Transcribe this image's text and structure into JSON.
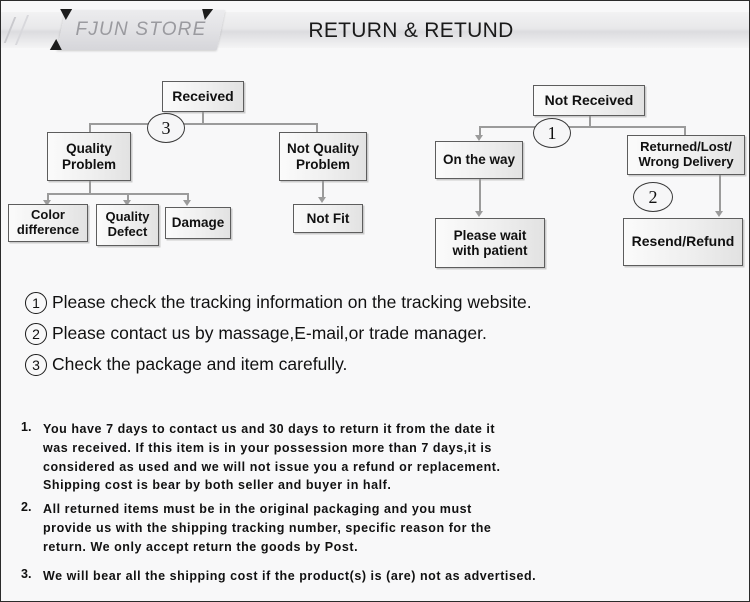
{
  "header": {
    "brand": "FJUN STORE",
    "title": "RETURN & RETUND"
  },
  "flowchart_left": {
    "boxes": [
      {
        "id": "received",
        "label": "Received"
      },
      {
        "id": "quality-problem",
        "label": "Quality\nProblem"
      },
      {
        "id": "not-quality-problem",
        "label": "Not Quality\nProblem"
      },
      {
        "id": "color-difference",
        "label": "Color\ndifference"
      },
      {
        "id": "quality-defect",
        "label": "Quality\nDefect"
      },
      {
        "id": "damage",
        "label": "Damage"
      },
      {
        "id": "not-fit",
        "label": "Not Fit"
      }
    ],
    "badge": "3"
  },
  "flowchart_right": {
    "boxes": [
      {
        "id": "not-received",
        "label": "Not  Received"
      },
      {
        "id": "on-the-way",
        "label": "On the way"
      },
      {
        "id": "returned-lost",
        "label": "Returned/Lost/\nWrong Delivery"
      },
      {
        "id": "please-wait",
        "label": "Please wait\nwith patient"
      },
      {
        "id": "resend-refund",
        "label": "Resend/Refund"
      }
    ],
    "badge_1": "1",
    "badge_2": "2"
  },
  "notes": [
    {
      "num": "1",
      "text": "Please check the tracking information on the tracking website."
    },
    {
      "num": "2",
      "text": "Please contact us by  massage,E-mail,or trade manager."
    },
    {
      "num": "3",
      "text": "Check the package and item carefully."
    }
  ],
  "policies": [
    {
      "num": "1.",
      "lines": [
        "You have 7 days to contact us and 30 days to return it from the date it",
        "was received. If this item is in your possession more than 7 days,it is",
        "considered as used and we will not issue you a refund or replacement.",
        "Shipping cost is bear by both seller and buyer in half."
      ]
    },
    {
      "num": "2.",
      "lines": [
        "All returned items must be in the original packaging and you must",
        "provide us with the shipping tracking number, specific reason for the",
        "return. We only accept return the goods by Post."
      ]
    },
    {
      "num": "3.",
      "lines": [
        "We will bear all the shipping cost if the product(s) is (are) not as advertised."
      ]
    }
  ],
  "colors": {
    "page_bg": "#f8f8f9",
    "border": "#2b2b2b",
    "box_border": "#5d5d5d",
    "connector": "#9b9b9b",
    "brand_text": "#9a9a9f"
  }
}
